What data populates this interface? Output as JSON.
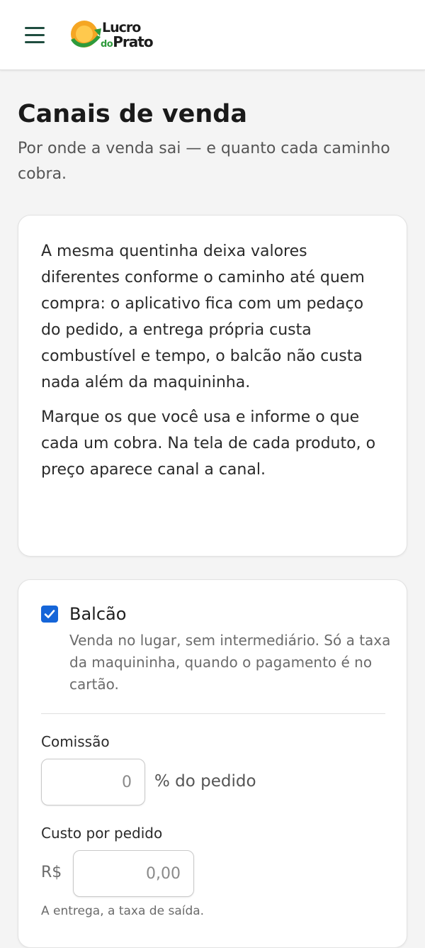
{
  "header": {
    "logo": {
      "line1": "Lucro",
      "line2_small": "do",
      "line2_big": "Prato"
    },
    "icons": {
      "menu": "hamburger-menu-icon",
      "logo": "lucro-do-prato-logo"
    },
    "colors": {
      "brand_green": "#1f4d3f",
      "logo_orange": "#f5a623",
      "logo_green": "#2e9a3b"
    }
  },
  "page": {
    "title": "Canais de venda",
    "subtitle": "Por onde a venda sai — e quanto cada caminho cobra."
  },
  "intro": {
    "paragraph1": "A mesma quentinha deixa valores diferentes conforme o caminho até quem compra: o aplicativo fica com um pedaço do pedido, a entrega própria custa combustível e tempo, o balcão não custa nada além da maquininha.",
    "paragraph2": "Marque os que você usa e informe o que cada um cobra. Na tela de cada produto, o preço aparece canal a canal."
  },
  "channel": {
    "name": "Balcão",
    "checked": true,
    "description": "Venda no lugar, sem intermediário. Só a taxa da maquininha, quando o pagamento é no cartão.",
    "commission": {
      "label": "Comissão",
      "value": "0",
      "suffix": "% do pedido"
    },
    "cost_per_order": {
      "label": "Custo por pedido",
      "prefix": "R$",
      "placeholder": "0,00"
    },
    "hint": "A entrega, a taxa de saída.",
    "colors": {
      "checkbox": "#1565d8"
    }
  }
}
